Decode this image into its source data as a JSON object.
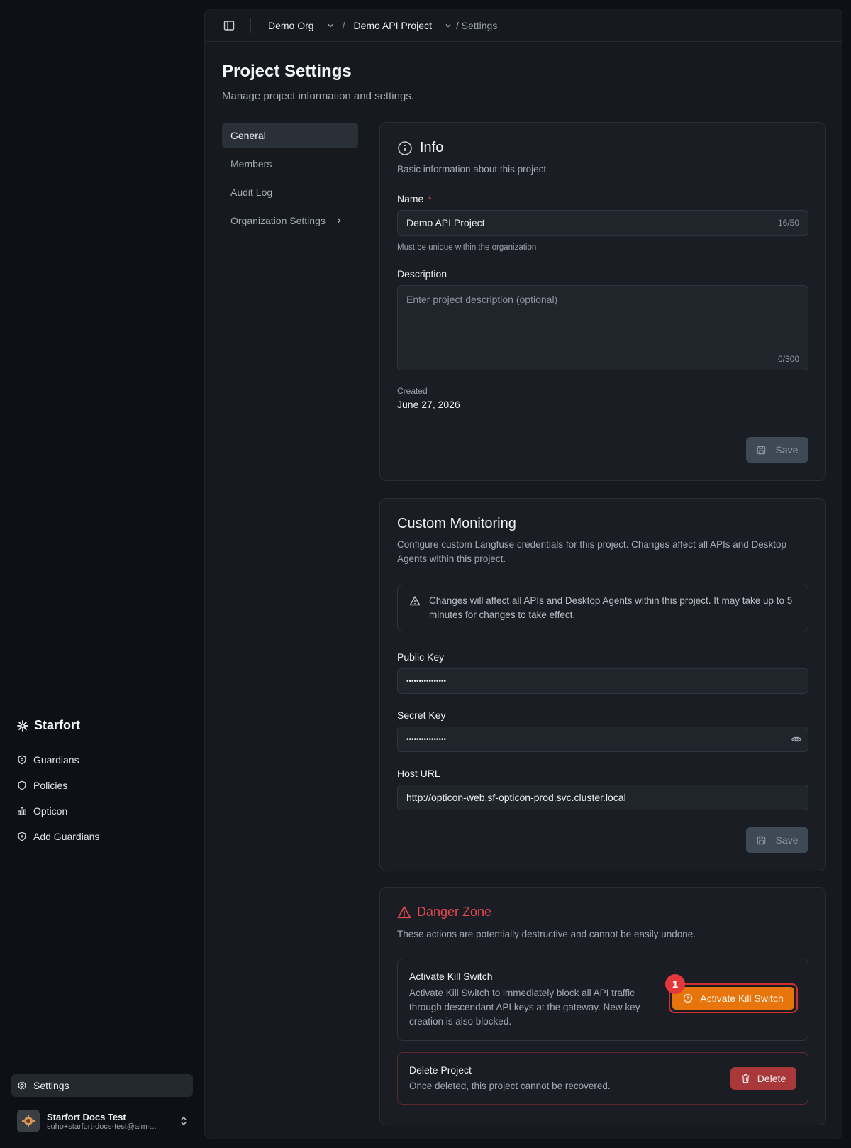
{
  "sidebar": {
    "brand": "Starfort",
    "items": [
      {
        "label": "Guardians",
        "icon": "shield-icon"
      },
      {
        "label": "Policies",
        "icon": "shield-icon"
      },
      {
        "label": "Opticon",
        "icon": "bar-chart-icon"
      },
      {
        "label": "Add Guardians",
        "icon": "shield-plus-icon"
      }
    ],
    "settings_label": "Settings",
    "user": {
      "name": "Starfort Docs Test",
      "email": "suho+starfort-docs-test@aim-..."
    }
  },
  "topbar": {
    "org": "Demo Org",
    "project": "Demo API Project",
    "current": "/ Settings"
  },
  "page": {
    "title": "Project Settings",
    "subtitle": "Manage project information and settings."
  },
  "subnav": {
    "items": [
      "General",
      "Members",
      "Audit Log",
      "Organization Settings"
    ]
  },
  "info_card": {
    "title": "Info",
    "description": "Basic information about this project",
    "name_label": "Name",
    "name_required": "*",
    "name_value": "Demo API Project",
    "name_counter": "16/50",
    "name_hint": "Must be unique within the organization",
    "description_label": "Description",
    "description_placeholder": "Enter project description (optional)",
    "description_counter": "0/300",
    "created_label": "Created",
    "created_value": "June 27, 2026",
    "save_label": "Save"
  },
  "monitoring_card": {
    "title": "Custom Monitoring",
    "description": "Configure custom Langfuse credentials for this project. Changes affect all APIs and Desktop Agents within this project.",
    "alert": "Changes will affect all APIs and Desktop Agents within this project. It may take up to 5 minutes for changes to take effect.",
    "public_key_label": "Public Key",
    "public_key_value": "••••••••••••••••",
    "secret_key_label": "Secret Key",
    "secret_key_value": "••••••••••••••••",
    "host_label": "Host URL",
    "host_value": "http://opticon-web.sf-opticon-prod.svc.cluster.local",
    "save_label": "Save"
  },
  "danger_card": {
    "title": "Danger Zone",
    "description": "These actions are potentially destructive and cannot be easily undone.",
    "kill_title": "Activate Kill Switch",
    "kill_text": "Activate Kill Switch to immediately block all API traffic through descendant API keys at the gateway. New key creation is also blocked.",
    "kill_button": "Activate Kill Switch",
    "kill_badge": "1",
    "delete_title": "Delete Project",
    "delete_text": "Once deleted, this project cannot be recovered.",
    "delete_button": "Delete"
  },
  "colors": {
    "accent_orange": "#e8740c",
    "danger_red": "#e5484d",
    "delete_red": "#a8383a"
  }
}
